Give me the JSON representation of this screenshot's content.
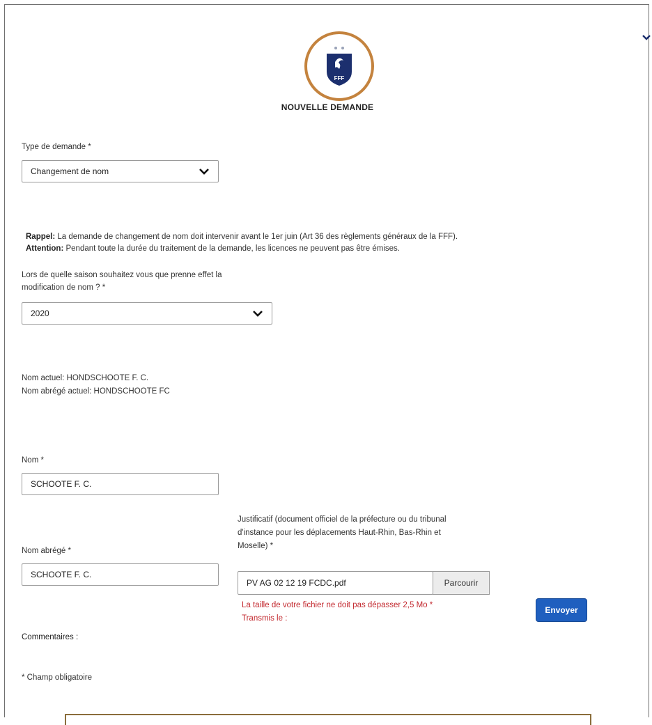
{
  "header": {
    "collapse_icon": "chevron-down-icon",
    "logo_text": "FFF",
    "title": "NOUVELLE DEMANDE"
  },
  "form": {
    "type_label": "Type de demande *",
    "type_value": "Changement de nom",
    "rappel_label": "Rappel:",
    "rappel_text": " La demande de changement de nom doit intervenir avant le 1er juin (Art 36 des règlements généraux de la FFF).",
    "attention_label": "Attention:",
    "attention_text": " Pendant toute la durée du traitement de la demande, les licences ne peuvent pas être émises.",
    "season_label_1": "Lors de quelle saison souhaitez vous que prenne effet la",
    "season_label_2": "modification de nom ? *",
    "season_value": "2020",
    "current_name": "Nom actuel: HONDSCHOOTE F. C.",
    "current_short": "Nom abrégé actuel: HONDSCHOOTE FC",
    "nom_label": "Nom *",
    "nom_value": "SCHOOTE F. C.",
    "justif_label_1": "Justificatif (document officiel de la préfecture ou du tribunal",
    "justif_label_2": "d'instance pour les déplacements Haut-Rhin, Bas-Rhin et",
    "justif_label_3": "Moselle) *",
    "nom_abrege_label": "Nom abrégé *",
    "nom_abrege_value": "SCHOOTE F. C.",
    "file_value": "PV AG 02 12 19 FCDC.pdf",
    "browse_label": "Parcourir",
    "size_warning": "La taille de votre fichier ne doit pas dépasser 2,5 Mo *",
    "transmis": "Transmis le :",
    "comments_label": "Commentaires :",
    "send_label": "Envoyer",
    "required_note": "* Champ obligatoire"
  },
  "colors": {
    "accent": "#1f5fbf",
    "error": "#c2272d",
    "logo_ring": "#c4833e",
    "logo_blue": "#1c2f6e"
  }
}
